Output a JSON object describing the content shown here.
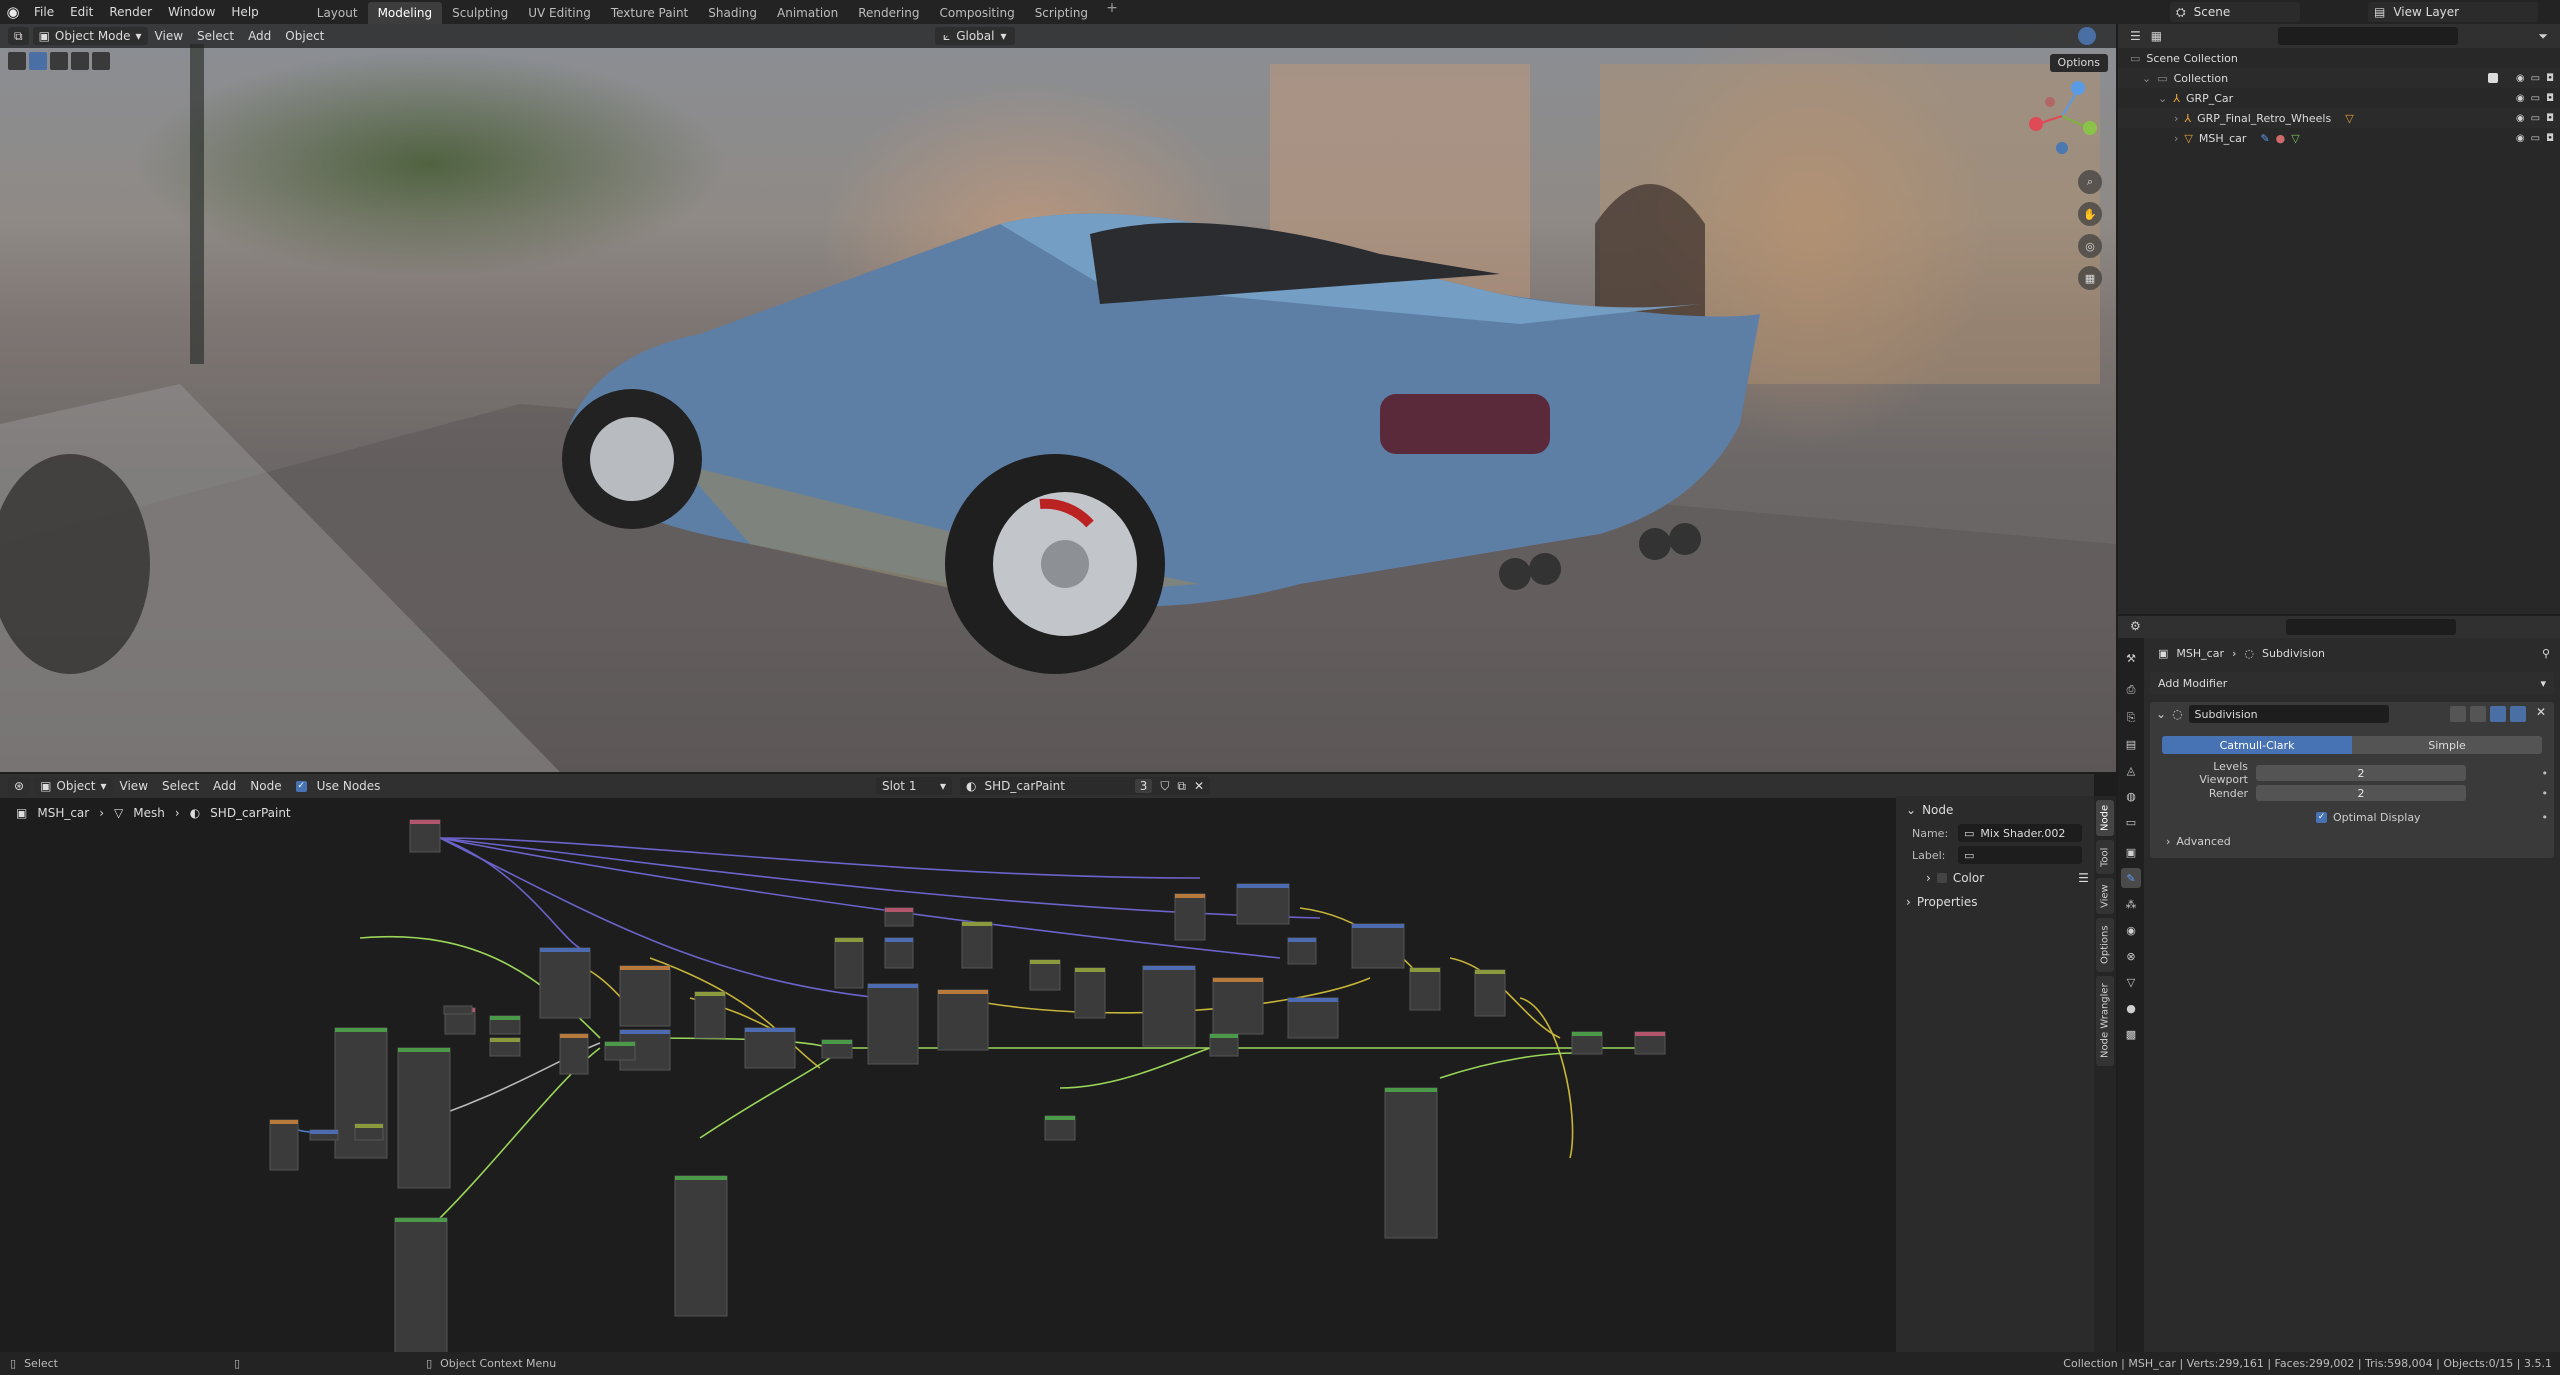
{
  "topbar": {
    "menus": [
      "File",
      "Edit",
      "Render",
      "Window",
      "Help"
    ],
    "workspaces": [
      "Layout",
      "Modeling",
      "Sculpting",
      "UV Editing",
      "Texture Paint",
      "Shading",
      "Animation",
      "Rendering",
      "Compositing",
      "Scripting"
    ],
    "active_workspace": "Modeling",
    "scene": "Scene",
    "view_layer": "View Layer"
  },
  "viewport": {
    "mode": "Object Mode",
    "menus": [
      "View",
      "Select",
      "Add",
      "Object"
    ],
    "orientation": "Global",
    "options_label": "Options"
  },
  "node_editor": {
    "object_type": "Object",
    "menus": [
      "View",
      "Select",
      "Add",
      "Node"
    ],
    "use_nodes_label": "Use Nodes",
    "slot": "Slot 1",
    "material": "SHD_carPaint",
    "material_users": "3",
    "breadcrumb": [
      "MSH_car",
      "Mesh",
      "SHD_carPaint"
    ]
  },
  "node_panel": {
    "section_node": "Node",
    "name_label": "Name:",
    "name_value": "Mix Shader.002",
    "label_label": "Label:",
    "label_value": "",
    "color_label": "Color",
    "properties_label": "Properties",
    "side_tabs": [
      "Node",
      "Tool",
      "View",
      "Options",
      "Node Wrangler"
    ]
  },
  "outliner": {
    "root": "Scene Collection",
    "items": [
      {
        "label": "Collection",
        "depth": 1
      },
      {
        "label": "GRP_Car",
        "depth": 2
      },
      {
        "label": "GRP_Final_Retro_Wheels",
        "depth": 3
      },
      {
        "label": "MSH_car",
        "depth": 3
      }
    ]
  },
  "properties": {
    "breadcrumb_object": "MSH_car",
    "breadcrumb_modifier": "Subdivision",
    "add_modifier": "Add Modifier",
    "modifier": {
      "name": "Subdivision",
      "mode_options": [
        "Catmull-Clark",
        "Simple"
      ],
      "active_mode": "Catmull-Clark",
      "levels_viewport_label": "Levels Viewport",
      "levels_viewport": "2",
      "render_label": "Render",
      "render": "2",
      "optimal_display_label": "Optimal Display",
      "optimal_display": true,
      "advanced_label": "Advanced"
    }
  },
  "statusbar": {
    "left": "Select",
    "middle": "Object Context Menu",
    "right": "Collection | MSH_car | Verts:299,161 | Faces:299,002 | Tris:598,004 | Objects:0/15 | 3.5.1"
  },
  "colors": {
    "accent": "#4772b3",
    "panel_bg": "#2b2b2b",
    "background": "#1d1d1d",
    "header": "#303030"
  }
}
